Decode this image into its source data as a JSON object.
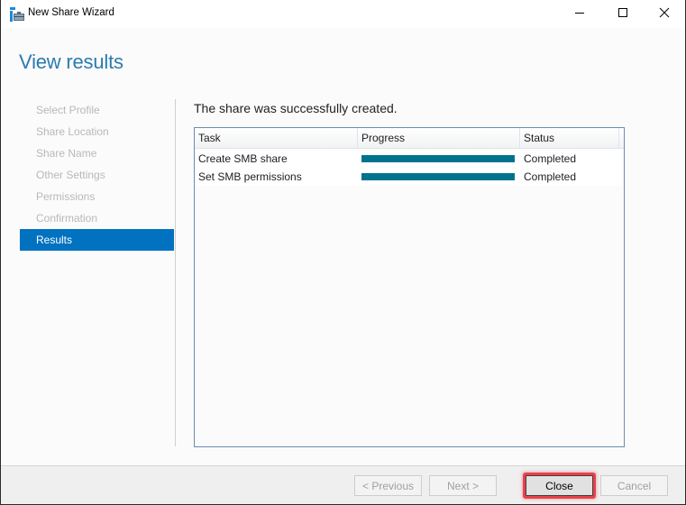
{
  "window": {
    "title": "New Share Wizard",
    "icon": "share-wizard-icon",
    "controls": {
      "minimize": "minimize-icon",
      "maximize": "maximize-icon",
      "close": "close-icon"
    }
  },
  "header": {
    "title": "View results"
  },
  "nav": {
    "items": [
      {
        "label": "Select Profile",
        "active": false
      },
      {
        "label": "Share Location",
        "active": false
      },
      {
        "label": "Share Name",
        "active": false
      },
      {
        "label": "Other Settings",
        "active": false
      },
      {
        "label": "Permissions",
        "active": false
      },
      {
        "label": "Confirmation",
        "active": false
      },
      {
        "label": "Results",
        "active": true
      }
    ]
  },
  "main": {
    "message": "The share was successfully created.",
    "table": {
      "columns": [
        "Task",
        "Progress",
        "Status"
      ],
      "rows": [
        {
          "task": "Create SMB share",
          "progress": 100,
          "status": "Completed"
        },
        {
          "task": "Set SMB permissions",
          "progress": 100,
          "status": "Completed"
        }
      ]
    }
  },
  "footer": {
    "previous_label": "< Previous",
    "next_label": "Next >",
    "close_label": "Close",
    "cancel_label": "Cancel"
  },
  "colors": {
    "accent": "#0072c0",
    "title": "#2b7bb0",
    "progress_fill": "#00728f",
    "highlight": "#e8414b"
  }
}
